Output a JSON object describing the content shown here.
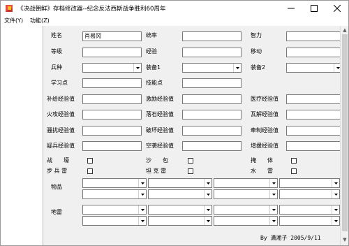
{
  "window": {
    "title": "《决战朝鲜》存档修改器--纪念反法西斯战争胜利60周年",
    "minimize_icon": "minimize-icon",
    "maximize_icon": "maximize-icon",
    "close_icon": "close-icon"
  },
  "menu": {
    "file": "文件(Y)",
    "function": "功能(Z)"
  },
  "form": {
    "name_label": "姓名",
    "name_value": "肖易冈",
    "command_label": "统率",
    "intelligence_label": "智力",
    "level_label": "等级",
    "experience_label": "经验",
    "movement_label": "移动",
    "branch_label": "兵种",
    "equip1_label": "装备1",
    "equip2_label": "装备2",
    "study_points_label": "学习点",
    "skill_points_label": "技能点",
    "supply_exp_label": "补给经验值",
    "inspire_exp_label": "激励经验值",
    "medical_exp_label": "医疗经验值",
    "fire_attack_exp_label": "火攻经验值",
    "falling_rock_exp_label": "落石经验值",
    "disintegrate_exp_label": "瓦解经验值",
    "harass_exp_label": "骚扰经验值",
    "destroy_exp_label": "破坏经验值",
    "restrain_exp_label": "牵制经验值",
    "suspect_troops_exp_label": "疑兵经验值",
    "air_raid_exp_label": "空袭经验值",
    "reinforce_exp_label": "增援经验值",
    "trench_label": "战　　壕",
    "sandbag_label": "沙　　包",
    "shelter_label": "掩　　体",
    "infantry_mine_label": "步 兵 雷",
    "tank_mine_label": "坦 克 雷",
    "water_mine_label": "水　　雷",
    "items_label": "物品",
    "mines_label": "地雷"
  },
  "credit": "By  潇湘子  2005/9/11"
}
